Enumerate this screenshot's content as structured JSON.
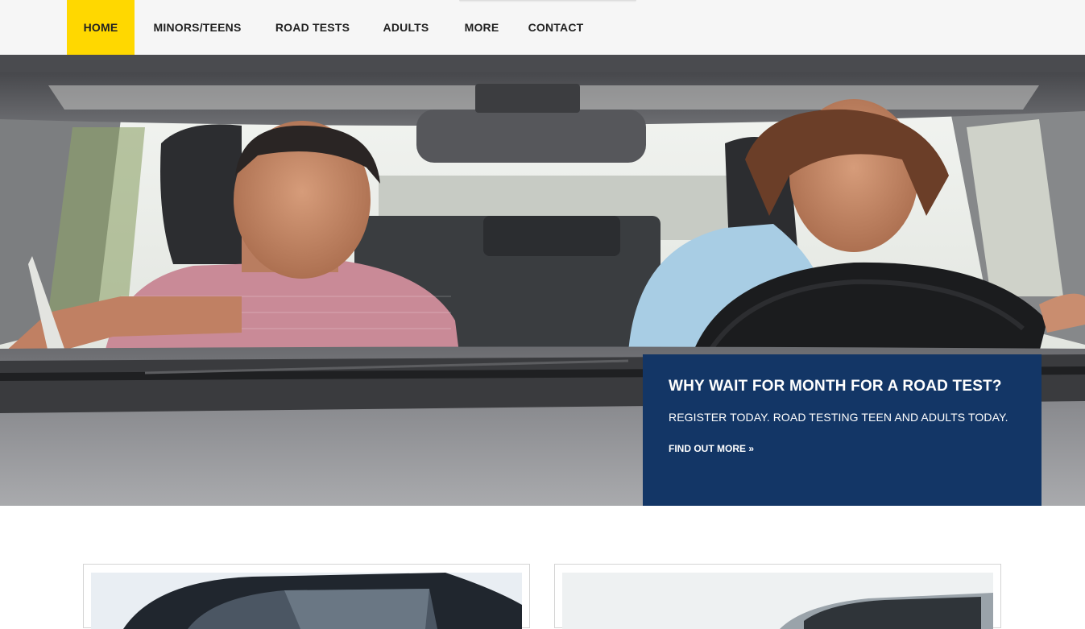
{
  "nav": {
    "items": [
      {
        "label": "HOME",
        "active": true
      },
      {
        "label": "MINORS/TEENS",
        "active": false
      },
      {
        "label": "ROAD TESTS",
        "active": false
      },
      {
        "label": "ADULTS",
        "active": false
      },
      {
        "label": "MORE",
        "active": false
      },
      {
        "label": "CONTACT",
        "active": false
      }
    ]
  },
  "hero": {
    "heading": "WHY WAIT FOR MONTH FOR A ROAD TEST?",
    "text": "REGISTER TODAY. ROAD TESTING TEEN AND ADULTS TODAY.",
    "link": "FIND OUT MORE »"
  },
  "colors": {
    "nav_active": "#ffd800",
    "callout_bg": "#133666",
    "nav_bg": "#f6f6f6"
  }
}
